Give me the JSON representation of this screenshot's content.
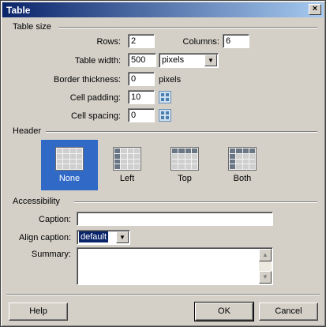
{
  "window": {
    "title": "Table",
    "close_glyph": "×"
  },
  "table_size": {
    "group_label": "Table size",
    "rows_label": "Rows:",
    "rows_value": "2",
    "columns_label": "Columns:",
    "columns_value": "6",
    "width_label": "Table width:",
    "width_value": "500",
    "width_unit": "pixels",
    "border_label": "Border thickness:",
    "border_value": "0",
    "border_unit": "pixels",
    "padding_label": "Cell padding:",
    "padding_value": "10",
    "spacing_label": "Cell spacing:",
    "spacing_value": "0"
  },
  "header": {
    "group_label": "Header",
    "options": [
      {
        "label": "None",
        "selected": true
      },
      {
        "label": "Left",
        "selected": false
      },
      {
        "label": "Top",
        "selected": false
      },
      {
        "label": "Both",
        "selected": false
      }
    ]
  },
  "accessibility": {
    "group_label": "Accessibility",
    "caption_label": "Caption:",
    "caption_value": "",
    "align_label": "Align caption:",
    "align_value": "default",
    "summary_label": "Summary:",
    "summary_value": ""
  },
  "buttons": {
    "help": "Help",
    "ok": "OK",
    "cancel": "Cancel"
  },
  "icons": {
    "dropdown": "chevron-down-icon",
    "close": "close-icon",
    "grid": "grid-icon"
  },
  "colors": {
    "title_bar": "#0a246a",
    "selection": "#3169c6",
    "dialog_bg": "#d4d0c8"
  }
}
